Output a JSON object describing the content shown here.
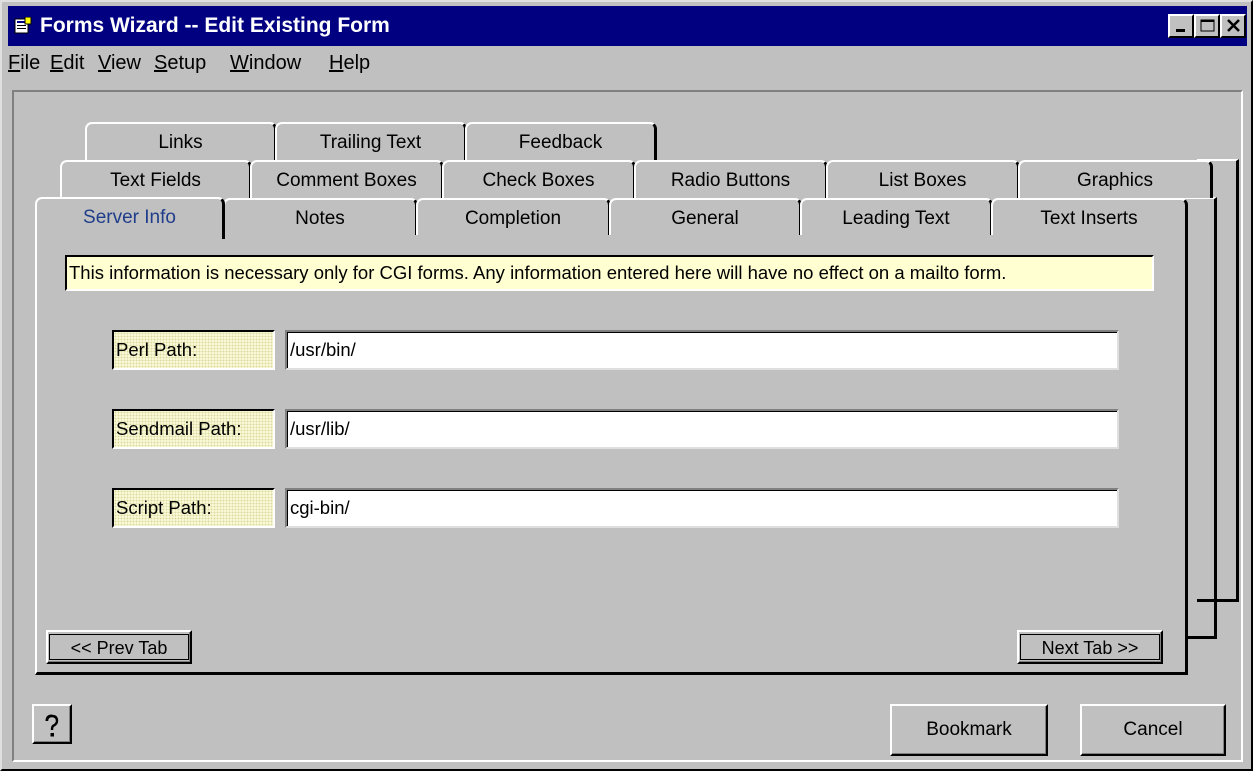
{
  "window": {
    "title": "Forms Wizard -- Edit Existing Form",
    "controls": [
      "minimize",
      "maximize",
      "close"
    ]
  },
  "menu": [
    {
      "label": "File"
    },
    {
      "label": "Edit"
    },
    {
      "label": "View"
    },
    {
      "label": "Setup"
    },
    {
      "label": "Window"
    },
    {
      "label": "Help"
    }
  ],
  "tabs": {
    "row1": [
      "Links",
      "Trailing Text",
      "Feedback"
    ],
    "row2": [
      "Text Fields",
      "Comment Boxes",
      "Check Boxes",
      "Radio Buttons",
      "List Boxes",
      "Graphics"
    ],
    "row3": [
      "Server Info",
      "Notes",
      "Completion",
      "General",
      "Leading Text",
      "Text Inserts"
    ],
    "active": "Server Info"
  },
  "server_info": {
    "note": "This information is necessary only for CGI forms.  Any information entered here will have no effect on a mailto form.",
    "fields": [
      {
        "label": "Perl Path:",
        "value": "/usr/bin/"
      },
      {
        "label": "Sendmail Path:",
        "value": "/usr/lib/"
      },
      {
        "label": "Script Path:",
        "value": "cgi-bin/"
      }
    ]
  },
  "nav": {
    "prev_label": "<< Prev Tab",
    "next_label": "Next Tab >>"
  },
  "footer": {
    "help_icon": "question-mark-icon",
    "bookmark_label": "Bookmark",
    "cancel_label": "Cancel"
  },
  "colors": {
    "titlebar": "#000080",
    "face": "#c0c0c0",
    "note_bg": "#ffffd2",
    "active_tab_text": "#1f3d8a"
  }
}
